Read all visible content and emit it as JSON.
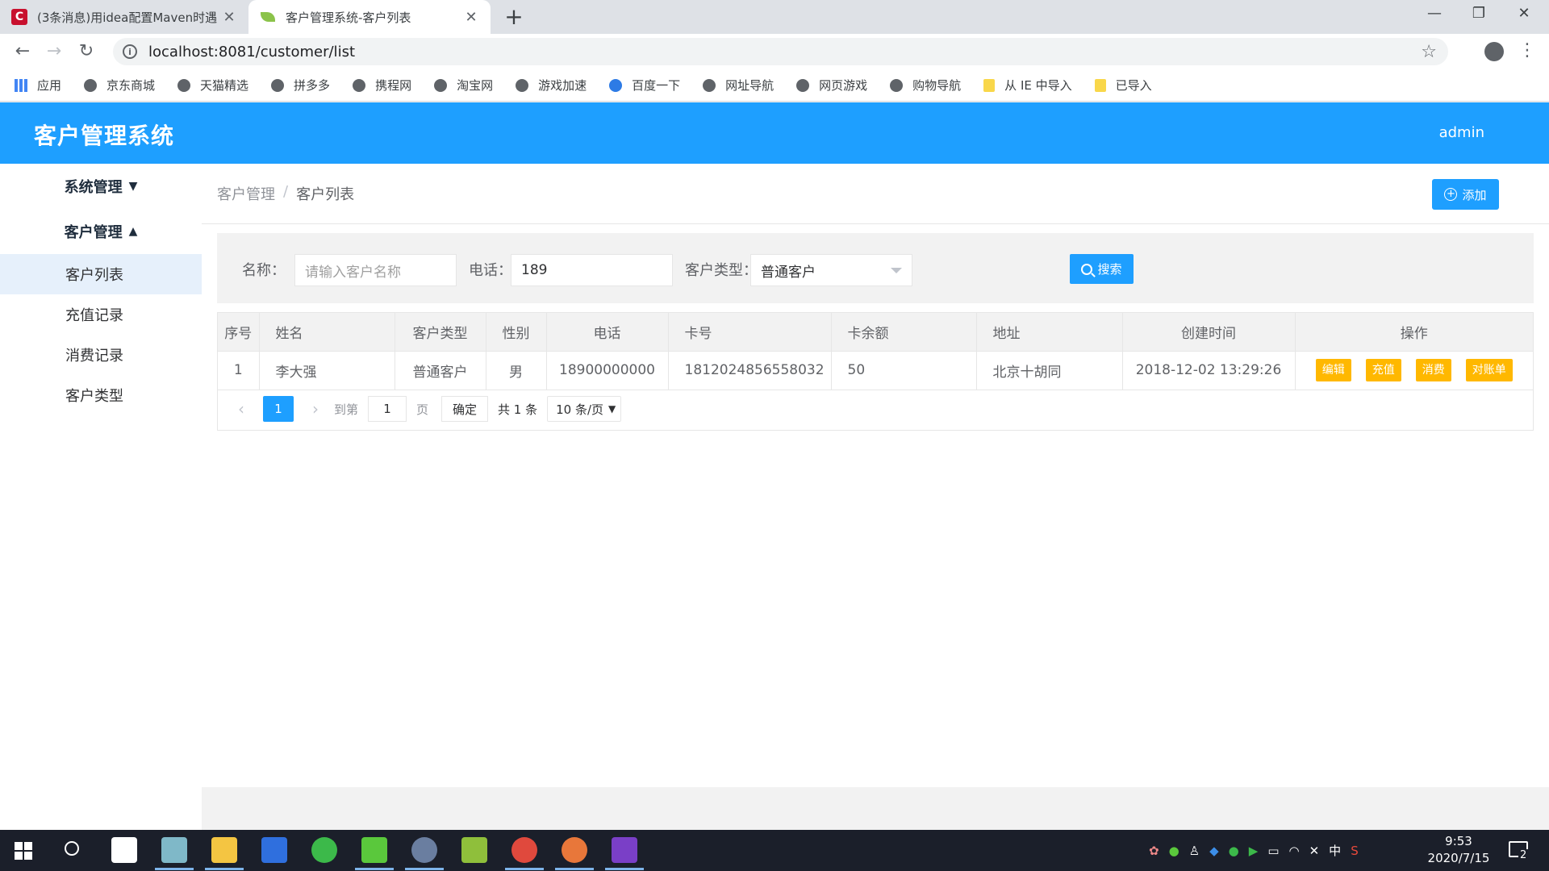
{
  "browser": {
    "tabs": [
      {
        "title": "(3条消息)用idea配置Maven时遇",
        "favicon": "C",
        "active": false
      },
      {
        "title": "客户管理系统-客户列表",
        "active": true
      }
    ],
    "url": "localhost:8081/customer/list",
    "bookmarks": [
      "应用",
      "京东商城",
      "天猫精选",
      "拼多多",
      "携程网",
      "淘宝网",
      "游戏加速",
      "百度一下",
      "网址导航",
      "网页游戏",
      "购物导航",
      "从 IE 中导入",
      "已导入"
    ]
  },
  "app": {
    "title": "客户管理系统",
    "user": "admin",
    "colors": {
      "primary": "#1e9fff",
      "warning": "#ffb800"
    }
  },
  "sidebar": {
    "groups": [
      {
        "label": "系统管理",
        "expanded": false
      },
      {
        "label": "客户管理",
        "expanded": true,
        "items": [
          "客户列表",
          "充值记录",
          "消费记录",
          "客户类型"
        ],
        "active": "客户列表"
      }
    ]
  },
  "main": {
    "breadcrumb": [
      "客户管理",
      "客户列表"
    ],
    "add_label": "添加",
    "search": {
      "name_label": "名称：",
      "name_placeholder": "请输入客户名称",
      "name_value": "",
      "phone_label": "电话：",
      "phone_value": "189",
      "type_label": "客户类型：",
      "type_value": "普通客户",
      "search_label": "搜索"
    },
    "table": {
      "columns": [
        "序号",
        "姓名",
        "客户类型",
        "性别",
        "电话",
        "卡号",
        "卡余额",
        "地址",
        "创建时间",
        "操作"
      ],
      "rows": [
        {
          "index": "1",
          "name": "李大强",
          "type": "普通客户",
          "gender": "男",
          "phone": "18900000000",
          "card": "1812024856558032",
          "balance": "50",
          "address": "北京十胡同",
          "created": "2018-12-02 13:29:26"
        }
      ],
      "actions": [
        "编辑",
        "充值",
        "消费",
        "对账单"
      ]
    },
    "pager": {
      "current_page": "1",
      "goto_label": "到第",
      "goto_value": "1",
      "page_suffix": "页",
      "confirm_label": "确定",
      "total": "共 1 条",
      "page_size": "10 条/页"
    }
  },
  "taskbar": {
    "time": "9:53",
    "date": "2020/7/15",
    "ime": "中",
    "notifications": "2"
  }
}
